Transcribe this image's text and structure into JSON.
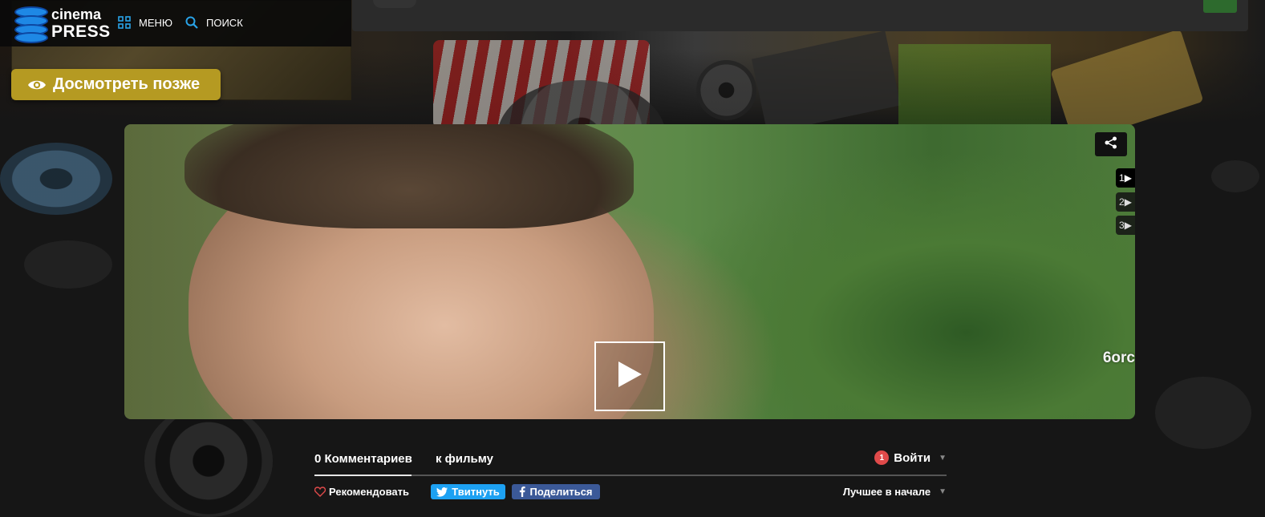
{
  "header": {
    "logo": {
      "line1": "cinema",
      "line2": "PRESS"
    },
    "menu_label": "МЕНЮ",
    "search_label": "ПОИСК"
  },
  "watch_later": {
    "label": "Досмотреть позже",
    "icon": "eye-icon"
  },
  "player": {
    "share_icon": "share-icon",
    "episodes": [
      "1▶",
      "2▶",
      "3▶"
    ],
    "active_episode": 0,
    "watermark": "6orc",
    "play_icon": "play-icon"
  },
  "comments": {
    "tab_count": "0 Комментариев",
    "tab_film": "к фильму",
    "login_badge": "1",
    "login_label": "Войти",
    "recommend_label": "Рекомендовать",
    "tweet_label": "Твитнуть",
    "share_label": "Поделиться",
    "sort_label": "Лучшее в начале"
  },
  "colors": {
    "accent_gold": "#b59a22",
    "twitter": "#1da1f2",
    "facebook": "#3b5998",
    "badge_red": "#e04a4a",
    "logo_blue": "#1e88e5"
  }
}
